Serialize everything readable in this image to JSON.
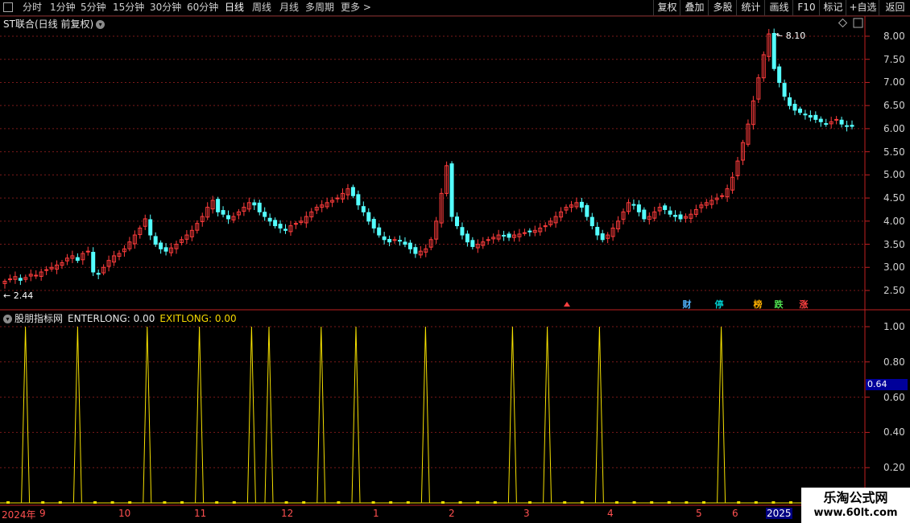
{
  "toolbar": {
    "left": [
      "分时",
      "1分钟",
      "5分钟",
      "15分钟",
      "30分钟",
      "60分钟",
      "日线",
      "周线",
      "月线",
      "多周期",
      "更多 >"
    ],
    "active_index": 6,
    "right": [
      "复权",
      "叠加",
      "多股",
      "统计",
      "画线",
      "F10",
      "标记",
      "+自选",
      "返回"
    ]
  },
  "main_chart": {
    "title": "ST联合(日线 前复权)",
    "y_ticks": [
      "8.00",
      "7.50",
      "7.00",
      "6.50",
      "6.00",
      "5.50",
      "5.00",
      "4.50",
      "4.00",
      "3.50",
      "3.00",
      "2.50"
    ],
    "high_label": "8.10",
    "low_label": "2.44",
    "markers": [
      {
        "label": "财",
        "color": "#50b4ff"
      },
      {
        "label": "停",
        "color": "#00c8c8"
      },
      {
        "label": "榜",
        "color": "#ffb000"
      },
      {
        "label": "跌",
        "color": "#50e050"
      },
      {
        "label": "涨",
        "color": "#ff4040"
      }
    ]
  },
  "indicator": {
    "name": "股朋指标网",
    "enter_label": "ENTERLONG: 0.00",
    "exit_label": "EXITLONG: 0.00",
    "y_ticks": [
      "1.00",
      "0.80",
      "0.60",
      "0.40",
      "0.20"
    ],
    "current_value": "0.64"
  },
  "x_axis": {
    "labels": [
      "2024年",
      "9",
      "10",
      "11",
      "12",
      "1",
      "2",
      "3",
      "4",
      "5",
      "6",
      "2025"
    ]
  },
  "watermark": {
    "line1": "乐淘公式网",
    "line2": "www.60lt.com"
  },
  "chart_data": [
    {
      "type": "candlestick",
      "title": "ST联合(日线 前复权)",
      "ylim": [
        2.2,
        8.3
      ],
      "x_labels": [
        "2024年",
        "9",
        "10",
        "11",
        "12",
        "1",
        "2",
        "3",
        "4",
        "5",
        "6",
        "2025"
      ],
      "series_close": [
        2.7,
        2.75,
        2.8,
        2.72,
        2.78,
        2.85,
        2.83,
        2.9,
        2.95,
        3.0,
        3.05,
        3.1,
        3.2,
        3.25,
        3.15,
        3.3,
        3.35,
        2.9,
        2.85,
        3.0,
        3.15,
        3.25,
        3.3,
        3.4,
        3.55,
        3.7,
        3.85,
        4.05,
        3.7,
        3.5,
        3.4,
        3.35,
        3.42,
        3.5,
        3.6,
        3.7,
        3.8,
        3.95,
        4.1,
        4.3,
        4.45,
        4.2,
        4.15,
        4.05,
        4.1,
        4.2,
        4.3,
        4.4,
        4.35,
        4.2,
        4.1,
        4.0,
        3.9,
        3.85,
        3.8,
        3.9,
        3.95,
        4.0,
        4.1,
        4.2,
        4.3,
        4.35,
        4.4,
        4.45,
        4.5,
        4.6,
        4.7,
        4.55,
        4.35,
        4.2,
        4.0,
        3.85,
        3.7,
        3.6,
        3.55,
        3.6,
        3.58,
        3.5,
        3.4,
        3.3,
        3.35,
        3.4,
        3.6,
        4.0,
        4.6,
        5.2,
        4.1,
        3.9,
        3.7,
        3.55,
        3.45,
        3.5,
        3.55,
        3.6,
        3.65,
        3.7,
        3.68,
        3.65,
        3.7,
        3.72,
        3.75,
        3.78,
        3.8,
        3.85,
        3.9,
        4.0,
        4.1,
        4.2,
        4.3,
        4.35,
        4.4,
        4.3,
        4.1,
        3.9,
        3.7,
        3.6,
        3.7,
        3.85,
        4.0,
        4.2,
        4.4,
        4.35,
        4.2,
        4.05,
        4.1,
        4.2,
        4.3,
        4.25,
        4.15,
        4.1,
        4.05,
        4.1,
        4.15,
        4.25,
        4.35,
        4.4,
        4.45,
        4.5,
        4.55,
        4.7,
        4.95,
        5.3,
        5.7,
        6.1,
        6.6,
        7.1,
        7.6,
        8.05,
        7.3,
        7.0,
        6.7,
        6.5,
        6.4,
        6.35,
        6.3,
        6.25,
        6.2,
        6.15,
        6.1,
        6.15,
        6.2,
        6.1,
        6.05,
        6.05
      ],
      "high": 8.1,
      "low": 2.44
    },
    {
      "type": "line",
      "title": "股朋指标网",
      "ylim": [
        0,
        1.1
      ],
      "series": [
        {
          "name": "ENTERLONG",
          "values": [
            0,
            1,
            0,
            0,
            1,
            0,
            0,
            0,
            1,
            0,
            0,
            1,
            0,
            0,
            1,
            1,
            0,
            0,
            1,
            0,
            1,
            0,
            0,
            0,
            1,
            0,
            0,
            0,
            0,
            1,
            0,
            1,
            0,
            0,
            1,
            0,
            0,
            0,
            0,
            0,
            0,
            1,
            0,
            0,
            0,
            0
          ]
        },
        {
          "name": "EXITLONG",
          "values": [
            0,
            0,
            0,
            0,
            0,
            0,
            0,
            0,
            0,
            0,
            0,
            0,
            0,
            0,
            0,
            0,
            0,
            0,
            0,
            0,
            0,
            0,
            0,
            0,
            0,
            0,
            0,
            0,
            0,
            0,
            0,
            0,
            0,
            0,
            0,
            0,
            0,
            0,
            0,
            0,
            0,
            0,
            0,
            0,
            0,
            0
          ]
        }
      ],
      "current_value": 0.64
    }
  ]
}
